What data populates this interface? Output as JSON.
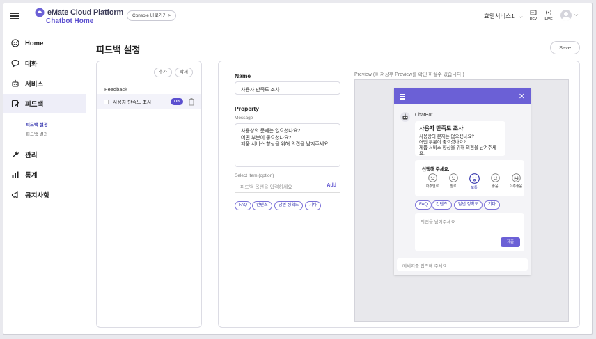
{
  "header": {
    "brand": "eMate Cloud Platform",
    "brand_sub": "Chatbot  Home",
    "console_button": "Console 바로가기  >",
    "service_select": "효엔서비스1",
    "dev_label": "DEV",
    "live_label": "LIVE"
  },
  "sidebar": {
    "items": [
      {
        "label": "Home",
        "icon": "smile-icon"
      },
      {
        "label": "대화",
        "icon": "chat-bubble-icon"
      },
      {
        "label": "서비스",
        "icon": "robot-icon"
      },
      {
        "label": "피드백",
        "icon": "feedback-icon"
      },
      {
        "label": "관리",
        "icon": "wrench-icon"
      },
      {
        "label": "통계",
        "icon": "bar-chart-icon"
      },
      {
        "label": "공지사항",
        "icon": "megaphone-icon"
      }
    ],
    "sub_items": [
      "피드백 설정",
      "피드백 결과"
    ]
  },
  "page": {
    "title": "피드백 설정",
    "save_label": "Save"
  },
  "left_panel": {
    "add_label": "추가",
    "delete_label": "삭제",
    "feedback_label": "Feedback",
    "row_name": "사용자 만족도 조사",
    "toggle_label": "On"
  },
  "form": {
    "name_label": "Name",
    "name_value": "사용자 만족도 조사",
    "property_label": "Property",
    "message_label": "Message",
    "message_value": "사용상의 문제는 없으셨나요?\n어떤 부분이 좋으셨나요?\n제품 서비스 향상을 위해 의견을 남겨주세요.",
    "select_label": "Select Item (option)",
    "select_placeholder": "피드백 옵션을 입력하세요",
    "add_link": "Add",
    "chips": [
      "FAQ",
      "컨텐츠",
      "답변 정확도",
      "기타"
    ]
  },
  "preview": {
    "label": "Preview (※ 저장후 Preview를 확인 하실수 있습니다.)",
    "bot_name": "ChatBot",
    "bubble_title": "사용자 만족도 조사",
    "bubble_lines": [
      "사용상의 문제는 없으셨나요?",
      "어떤 부분이 좋으셨나요?",
      "제품 서비스 향상을 위해 의견을 남겨주세요."
    ],
    "rating_prompt": "선택해 주세요.",
    "faces": [
      "아주별로",
      "별로",
      "보통",
      "좋음",
      "아주좋음"
    ],
    "selected_face": 2,
    "chips": [
      "FAQ",
      "컨텐츠",
      "답변 정확도",
      "기타"
    ],
    "opinion_placeholder": "의견을 남기주세요.",
    "submit_label": "제출",
    "message_placeholder": "메세지를 입력해 주세요."
  },
  "colors": {
    "accent": "#6b60d6",
    "active_bg": "#eeeef8"
  }
}
